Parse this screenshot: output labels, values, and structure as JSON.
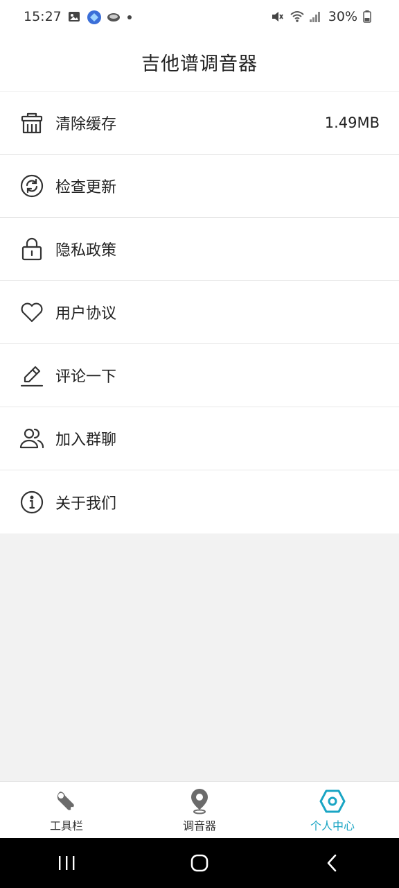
{
  "status_bar": {
    "time": "15:27",
    "battery": "30%",
    "left_icons": [
      "image-icon",
      "app-icon",
      "cloud-icon",
      "dot-icon"
    ],
    "right_icons": [
      "mute-icon",
      "wifi-icon",
      "signal-icon",
      "battery-icon"
    ]
  },
  "header": {
    "title": "吉他谱调音器"
  },
  "menu": {
    "items": [
      {
        "label": "清除缓存",
        "value": "1.49MB",
        "icon": "trash-icon"
      },
      {
        "label": "检查更新",
        "value": "",
        "icon": "refresh-icon"
      },
      {
        "label": "隐私政策",
        "value": "",
        "icon": "lock-icon"
      },
      {
        "label": "用户协议",
        "value": "",
        "icon": "heart-icon"
      },
      {
        "label": "评论一下",
        "value": "",
        "icon": "pencil-icon"
      },
      {
        "label": "加入群聊",
        "value": "",
        "icon": "users-icon"
      },
      {
        "label": "关于我们",
        "value": "",
        "icon": "info-icon"
      }
    ]
  },
  "tabbar": {
    "tabs": [
      {
        "label": "工具栏",
        "icon": "wrench-icon",
        "active": false
      },
      {
        "label": "调音器",
        "icon": "location-pin-icon",
        "active": false
      },
      {
        "label": "个人中心",
        "icon": "hexagon-icon",
        "active": true
      }
    ],
    "active_color": "#1aa5c4"
  },
  "nav_bar": {
    "buttons": [
      "recents-button",
      "home-button",
      "back-button"
    ]
  }
}
